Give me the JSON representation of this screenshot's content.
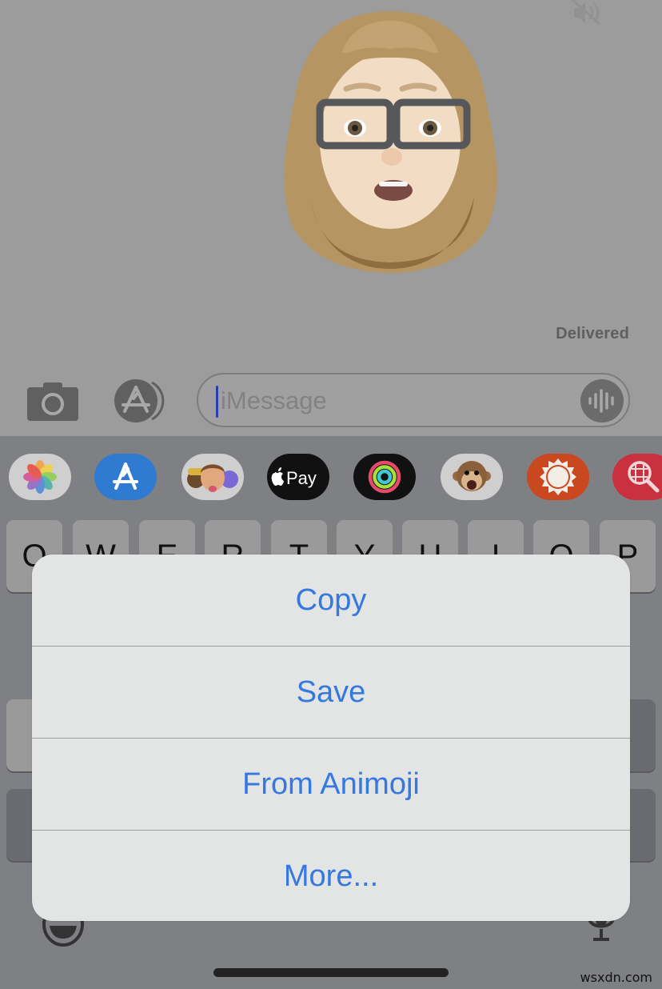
{
  "conversation": {
    "status": "Delivered",
    "message_type": "memoji-sticker",
    "mute_icon": "speaker-muted-icon"
  },
  "compose_bar": {
    "camera_icon": "camera-icon",
    "apps_icon": "app-store-icon",
    "input_placeholder": "iMessage",
    "input_value": "",
    "audio_icon": "audio-waveform-icon"
  },
  "app_drawer": {
    "apps": [
      {
        "name": "Photos",
        "icon": "photos-icon",
        "bg": "#cfcfcf"
      },
      {
        "name": "App Store",
        "icon": "app-store-icon",
        "bg": "#2f7bd2"
      },
      {
        "name": "Memoji Stickers",
        "icon": "memoji-icon",
        "bg": "#cfcfcf"
      },
      {
        "name": "Apple Pay",
        "icon": "apple-pay-icon",
        "label": "Pay",
        "bg": "#111111"
      },
      {
        "name": "Activity",
        "icon": "activity-rings-icon",
        "bg": "#111111"
      },
      {
        "name": "Animoji",
        "icon": "monkey-icon",
        "bg": "#cfcfcf"
      },
      {
        "name": "Weather",
        "icon": "sun-icon",
        "bg": "#c9481f"
      },
      {
        "name": "Web Search",
        "icon": "globe-search-icon",
        "bg": "#c9313f"
      }
    ]
  },
  "keyboard": {
    "row1": [
      "Q",
      "W",
      "E",
      "R",
      "T",
      "Y",
      "U",
      "I",
      "O",
      "P"
    ],
    "bottom_left_icon": "emoji-icon",
    "bottom_right_icon": "microphone-icon"
  },
  "action_sheet": {
    "items": [
      {
        "label": "Copy"
      },
      {
        "label": "Save"
      },
      {
        "label": "From Animoji"
      },
      {
        "label": "More..."
      }
    ],
    "text_color": "#3478e0"
  },
  "watermark": "wsxdn.com"
}
